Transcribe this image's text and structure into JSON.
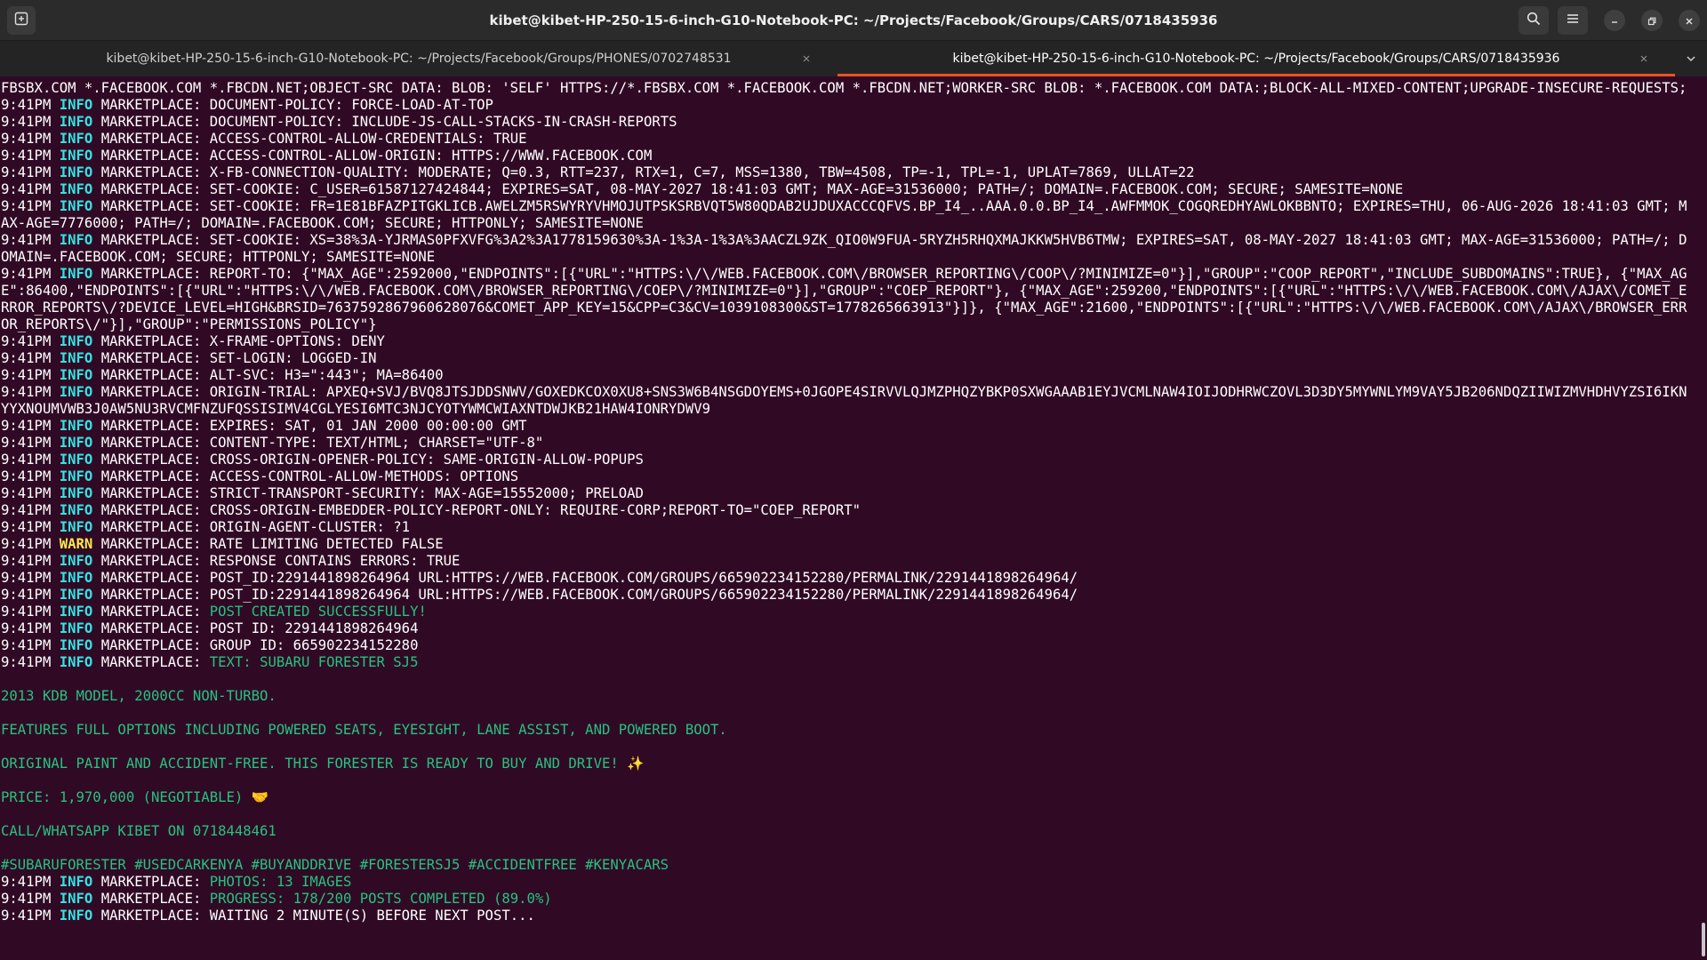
{
  "window": {
    "title": "kibet@kibet-HP-250-15-6-inch-G10-Notebook-PC: ~/Projects/Facebook/Groups/CARS/0718435936"
  },
  "tabs": [
    {
      "label": "kibet@kibet-HP-250-15-6-inch-G10-Notebook-PC: ~/Projects/Facebook/Groups/PHONES/0702748531",
      "active": false
    },
    {
      "label": "kibet@kibet-HP-250-15-6-inch-G10-Notebook-PC: ~/Projects/Facebook/Groups/CARS/0718435936",
      "active": true
    }
  ],
  "icons": {
    "new_tab": "new-tab-icon",
    "search": "search-icon",
    "menu": "hamburger-menu-icon",
    "minimize": "minimize-icon",
    "restore": "restore-icon",
    "close": "close-icon",
    "tab_close": "close-icon",
    "tab_menu": "chevron-down-icon"
  },
  "glyphs": {
    "tab_close": "×",
    "minimize": "–",
    "close": "✕"
  },
  "colors": {
    "background": "#300a24",
    "info": "#34e2e2",
    "warn": "#fce94f",
    "green_text": "#26c281",
    "accent": "#e95420"
  },
  "terminal": {
    "lines": [
      {
        "type": "plain",
        "text": "FBSBX.COM *.FACEBOOK.COM *.FBCDN.NET;OBJECT-SRC DATA: BLOB: 'SELF' HTTPS://*.FBSBX.COM *.FACEBOOK.COM *.FBCDN.NET;WORKER-SRC BLOB: *.FACEBOOK.COM DATA:;BLOCK-ALL-MIXED-CONTENT;UPGRADE-INSECURE-REQUESTS;"
      },
      {
        "type": "log",
        "time": "9:41PM",
        "level": "INFO",
        "tag": "MARKETPLACE:",
        "msg": "DOCUMENT-POLICY: FORCE-LOAD-AT-TOP"
      },
      {
        "type": "log",
        "time": "9:41PM",
        "level": "INFO",
        "tag": "MARKETPLACE:",
        "msg": "DOCUMENT-POLICY: INCLUDE-JS-CALL-STACKS-IN-CRASH-REPORTS"
      },
      {
        "type": "log",
        "time": "9:41PM",
        "level": "INFO",
        "tag": "MARKETPLACE:",
        "msg": "ACCESS-CONTROL-ALLOW-CREDENTIALS: TRUE"
      },
      {
        "type": "log",
        "time": "9:41PM",
        "level": "INFO",
        "tag": "MARKETPLACE:",
        "msg": "ACCESS-CONTROL-ALLOW-ORIGIN: HTTPS://WWW.FACEBOOK.COM"
      },
      {
        "type": "log",
        "time": "9:41PM",
        "level": "INFO",
        "tag": "MARKETPLACE:",
        "msg": "X-FB-CONNECTION-QUALITY: MODERATE; Q=0.3, RTT=237, RTX=1, C=7, MSS=1380, TBW=4508, TP=-1, TPL=-1, UPLAT=7869, ULLAT=22"
      },
      {
        "type": "log",
        "time": "9:41PM",
        "level": "INFO",
        "tag": "MARKETPLACE:",
        "msg": "SET-COOKIE: C_USER=61587127424844; EXPIRES=SAT, 08-MAY-2027 18:41:03 GMT; MAX-AGE=31536000; PATH=/; DOMAIN=.FACEBOOK.COM; SECURE; SAMESITE=NONE"
      },
      {
        "type": "log",
        "time": "9:41PM",
        "level": "INFO",
        "tag": "MARKETPLACE:",
        "msg": "SET-COOKIE: FR=1E81BFAZPITGKLICB.AWELZM5RSWYRYVHMOJUTPSKSRBVQT5W80QDAB2UJDUXACCCQFVS.BP_I4_..AAA.0.0.BP_I4_.AWFMMOK_COGQREDHYAWLOKBBNTO; EXPIRES=THU, 06-AUG-2026 18:41:03 GMT; MAX-AGE=7776000; PATH=/; DOMAIN=.FACEBOOK.COM; SECURE; HTTPONLY; SAMESITE=NONE"
      },
      {
        "type": "log",
        "time": "9:41PM",
        "level": "INFO",
        "tag": "MARKETPLACE:",
        "msg": "SET-COOKIE: XS=38%3A-YJRMAS0PFXVFG%3A2%3A1778159630%3A-1%3A-1%3A%3AACZL9ZK_QIO0W9FUA-5RYZH5RHQXMAJKKW5HVB6TMW; EXPIRES=SAT, 08-MAY-2027 18:41:03 GMT; MAX-AGE=31536000; PATH=/; DOMAIN=.FACEBOOK.COM; SECURE; HTTPONLY; SAMESITE=NONE"
      },
      {
        "type": "log",
        "time": "9:41PM",
        "level": "INFO",
        "tag": "MARKETPLACE:",
        "msg": "REPORT-TO: {\"MAX_AGE\":2592000,\"ENDPOINTS\":[{\"URL\":\"HTTPS:\\/\\/WEB.FACEBOOK.COM\\/BROWSER_REPORTING\\/COOP\\/?MINIMIZE=0\"}],\"GROUP\":\"COOP_REPORT\",\"INCLUDE_SUBDOMAINS\":TRUE}, {\"MAX_AGE\":86400,\"ENDPOINTS\":[{\"URL\":\"HTTPS:\\/\\/WEB.FACEBOOK.COM\\/BROWSER_REPORTING\\/COEP\\/?MINIMIZE=0\"}],\"GROUP\":\"COEP_REPORT\"}, {\"MAX_AGE\":259200,\"ENDPOINTS\":[{\"URL\":\"HTTPS:\\/\\/WEB.FACEBOOK.COM\\/AJAX\\/COMET_ERROR_REPORTS\\/?DEVICE_LEVEL=HIGH&BRSID=7637592867960628076&COMET_APP_KEY=15&CPP=C3&CV=1039108300&ST=1778265663913\"}]}, {\"MAX_AGE\":21600,\"ENDPOINTS\":[{\"URL\":\"HTTPS:\\/\\/WEB.FACEBOOK.COM\\/AJAX\\/BROWSER_ERROR_REPORTS\\/\"}],\"GROUP\":\"PERMISSIONS_POLICY\"}"
      },
      {
        "type": "log",
        "time": "9:41PM",
        "level": "INFO",
        "tag": "MARKETPLACE:",
        "msg": "X-FRAME-OPTIONS: DENY"
      },
      {
        "type": "log",
        "time": "9:41PM",
        "level": "INFO",
        "tag": "MARKETPLACE:",
        "msg": "SET-LOGIN: LOGGED-IN"
      },
      {
        "type": "log",
        "time": "9:41PM",
        "level": "INFO",
        "tag": "MARKETPLACE:",
        "msg": "ALT-SVC: H3=\":443\"; MA=86400"
      },
      {
        "type": "log",
        "time": "9:41PM",
        "level": "INFO",
        "tag": "MARKETPLACE:",
        "msg": "ORIGIN-TRIAL: APXEQ+SVJ/BVQ8JTSJDDSNWV/GOXEDKCOX0XU8+SNS3W6B4NSGDOYEMS+0JGOPE4SIRVVLQJMZPHQZYBKP0SXWGAAAB1EYJVCMLNAW4IOIJODHRWCZOVL3D3DY5MYWNLYM9VAY5JB206NDQZIIWIZMVHDHVYZSI6IKNYYXNOUMVWB3J0AW5NU3RVCMFNZUFQSSISIMV4CGLYESI6MTC3NJCYOTYWMCWIAXNTDWJKB21HAW4IONRYDWV9"
      },
      {
        "type": "log",
        "time": "9:41PM",
        "level": "INFO",
        "tag": "MARKETPLACE:",
        "msg": "EXPIRES: SAT, 01 JAN 2000 00:00:00 GMT"
      },
      {
        "type": "log",
        "time": "9:41PM",
        "level": "INFO",
        "tag": "MARKETPLACE:",
        "msg": "CONTENT-TYPE: TEXT/HTML; CHARSET=\"UTF-8\""
      },
      {
        "type": "log",
        "time": "9:41PM",
        "level": "INFO",
        "tag": "MARKETPLACE:",
        "msg": "CROSS-ORIGIN-OPENER-POLICY: SAME-ORIGIN-ALLOW-POPUPS"
      },
      {
        "type": "log",
        "time": "9:41PM",
        "level": "INFO",
        "tag": "MARKETPLACE:",
        "msg": "ACCESS-CONTROL-ALLOW-METHODS: OPTIONS"
      },
      {
        "type": "log",
        "time": "9:41PM",
        "level": "INFO",
        "tag": "MARKETPLACE:",
        "msg": "STRICT-TRANSPORT-SECURITY: MAX-AGE=15552000; PRELOAD"
      },
      {
        "type": "log",
        "time": "9:41PM",
        "level": "INFO",
        "tag": "MARKETPLACE:",
        "msg": "CROSS-ORIGIN-EMBEDDER-POLICY-REPORT-ONLY: REQUIRE-CORP;REPORT-TO=\"COEP_REPORT\""
      },
      {
        "type": "log",
        "time": "9:41PM",
        "level": "INFO",
        "tag": "MARKETPLACE:",
        "msg": "ORIGIN-AGENT-CLUSTER: ?1"
      },
      {
        "type": "log",
        "time": "9:41PM",
        "level": "WARN",
        "tag": "MARKETPLACE:",
        "msg": "RATE LIMITING DETECTED FALSE"
      },
      {
        "type": "log",
        "time": "9:41PM",
        "level": "INFO",
        "tag": "MARKETPLACE:",
        "msg": "RESPONSE CONTAINS ERRORS: TRUE"
      },
      {
        "type": "log",
        "time": "9:41PM",
        "level": "INFO",
        "tag": "MARKETPLACE:",
        "msg": "POST_ID:2291441898264964 URL:HTTPS://WEB.FACEBOOK.COM/GROUPS/665902234152280/PERMALINK/2291441898264964/"
      },
      {
        "type": "log",
        "time": "9:41PM",
        "level": "INFO",
        "tag": "MARKETPLACE:",
        "msg": "POST_ID:2291441898264964 URL:HTTPS://WEB.FACEBOOK.COM/GROUPS/665902234152280/PERMALINK/2291441898264964/"
      },
      {
        "type": "log",
        "time": "9:41PM",
        "level": "INFO",
        "tag": "MARKETPLACE:",
        "msg": "POST CREATED SUCCESSFULLY!",
        "green": true
      },
      {
        "type": "log",
        "time": "9:41PM",
        "level": "INFO",
        "tag": "MARKETPLACE:",
        "msg": "POST ID: 2291441898264964"
      },
      {
        "type": "log",
        "time": "9:41PM",
        "level": "INFO",
        "tag": "MARKETPLACE:",
        "msg": "GROUP ID: 665902234152280"
      },
      {
        "type": "log",
        "time": "9:41PM",
        "level": "INFO",
        "tag": "MARKETPLACE:",
        "msg": "TEXT: SUBARU FORESTER SJ5",
        "green": true
      },
      {
        "type": "blank"
      },
      {
        "type": "green",
        "text": "2013 KDB MODEL, 2000CC NON-TURBO."
      },
      {
        "type": "blank"
      },
      {
        "type": "green",
        "text": "FEATURES FULL OPTIONS INCLUDING POWERED SEATS, EYESIGHT, LANE ASSIST, AND POWERED BOOT."
      },
      {
        "type": "blank"
      },
      {
        "type": "green",
        "text": "ORIGINAL PAINT AND ACCIDENT-FREE. THIS FORESTER IS READY TO BUY AND DRIVE! ✨"
      },
      {
        "type": "blank"
      },
      {
        "type": "green",
        "text": "PRICE: 1,970,000 (NEGOTIABLE) 🤝"
      },
      {
        "type": "blank"
      },
      {
        "type": "green",
        "text": "CALL/WHATSAPP KIBET ON 0718448461"
      },
      {
        "type": "blank"
      },
      {
        "type": "green",
        "text": "#SUBARUFORESTER #USEDCARKENYA #BUYANDDRIVE #FORESTERSJ5 #ACCIDENTFREE #KENYACARS"
      },
      {
        "type": "log",
        "time": "9:41PM",
        "level": "INFO",
        "tag": "MARKETPLACE:",
        "msg": "PHOTOS: 13 IMAGES",
        "green": true
      },
      {
        "type": "log",
        "time": "9:41PM",
        "level": "INFO",
        "tag": "MARKETPLACE:",
        "msg": "PROGRESS: 178/200 POSTS COMPLETED (89.0%)",
        "green": true
      },
      {
        "type": "log",
        "time": "9:41PM",
        "level": "INFO",
        "tag": "MARKETPLACE:",
        "msg": "WAITING 2 MINUTE(S) BEFORE NEXT POST..."
      }
    ]
  }
}
